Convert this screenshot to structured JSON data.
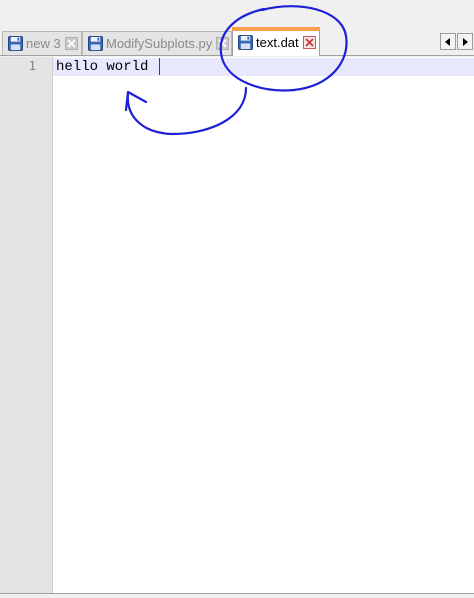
{
  "tabs": [
    {
      "label": "new 3",
      "active": false,
      "close_icon": "close-x-icon",
      "file_icon": "floppy-disk-icon"
    },
    {
      "label": "ModifySubplots.py",
      "active": false,
      "close_icon": "close-x-icon",
      "file_icon": "floppy-disk-icon"
    },
    {
      "label": "text.dat",
      "active": true,
      "close_icon": "close-x-icon",
      "file_icon": "floppy-disk-icon"
    }
  ],
  "tab_nav": {
    "prev_icon": "arrow-left-icon",
    "next_icon": "arrow-right-icon"
  },
  "editor": {
    "lines": [
      {
        "number": "1",
        "text": "hello world"
      }
    ]
  },
  "colors": {
    "active_tab_accent": "#f6a04b",
    "current_line_highlight": "#e8e8ff",
    "caret": "#8000ff",
    "annotation_ink": "#1f1fd6",
    "floppy_blue": "#3a66b6"
  },
  "annotations": [
    {
      "shape": "hand-drawn-circle",
      "target": "tab-text-dat"
    },
    {
      "shape": "hand-drawn-arrow",
      "target": "editor-line-1"
    }
  ]
}
